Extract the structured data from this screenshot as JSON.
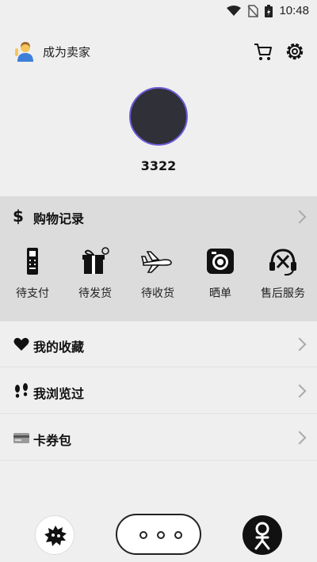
{
  "status_bar": {
    "time": "10:48"
  },
  "header": {
    "become_seller_label": "成为卖家"
  },
  "profile": {
    "username": "3322"
  },
  "orders": {
    "title": "购物记录",
    "items": [
      {
        "label": "待支付",
        "icon": "pos-terminal-icon"
      },
      {
        "label": "待发货",
        "icon": "gift-box-icon"
      },
      {
        "label": "待收货",
        "icon": "airplane-icon"
      },
      {
        "label": "晒单",
        "icon": "camera-icon"
      },
      {
        "label": "售后服务",
        "icon": "customer-service-icon"
      }
    ]
  },
  "menu": [
    {
      "label": "我的收藏",
      "icon": "heart-icon"
    },
    {
      "label": "我浏览过",
      "icon": "footprints-icon"
    },
    {
      "label": "卡券包",
      "icon": "card-icon"
    }
  ],
  "colors": {
    "background": "#efefef",
    "orders_panel": "#dcdcdc",
    "avatar_ring": "#6c5bd6",
    "avatar_fill": "#2f3038"
  }
}
